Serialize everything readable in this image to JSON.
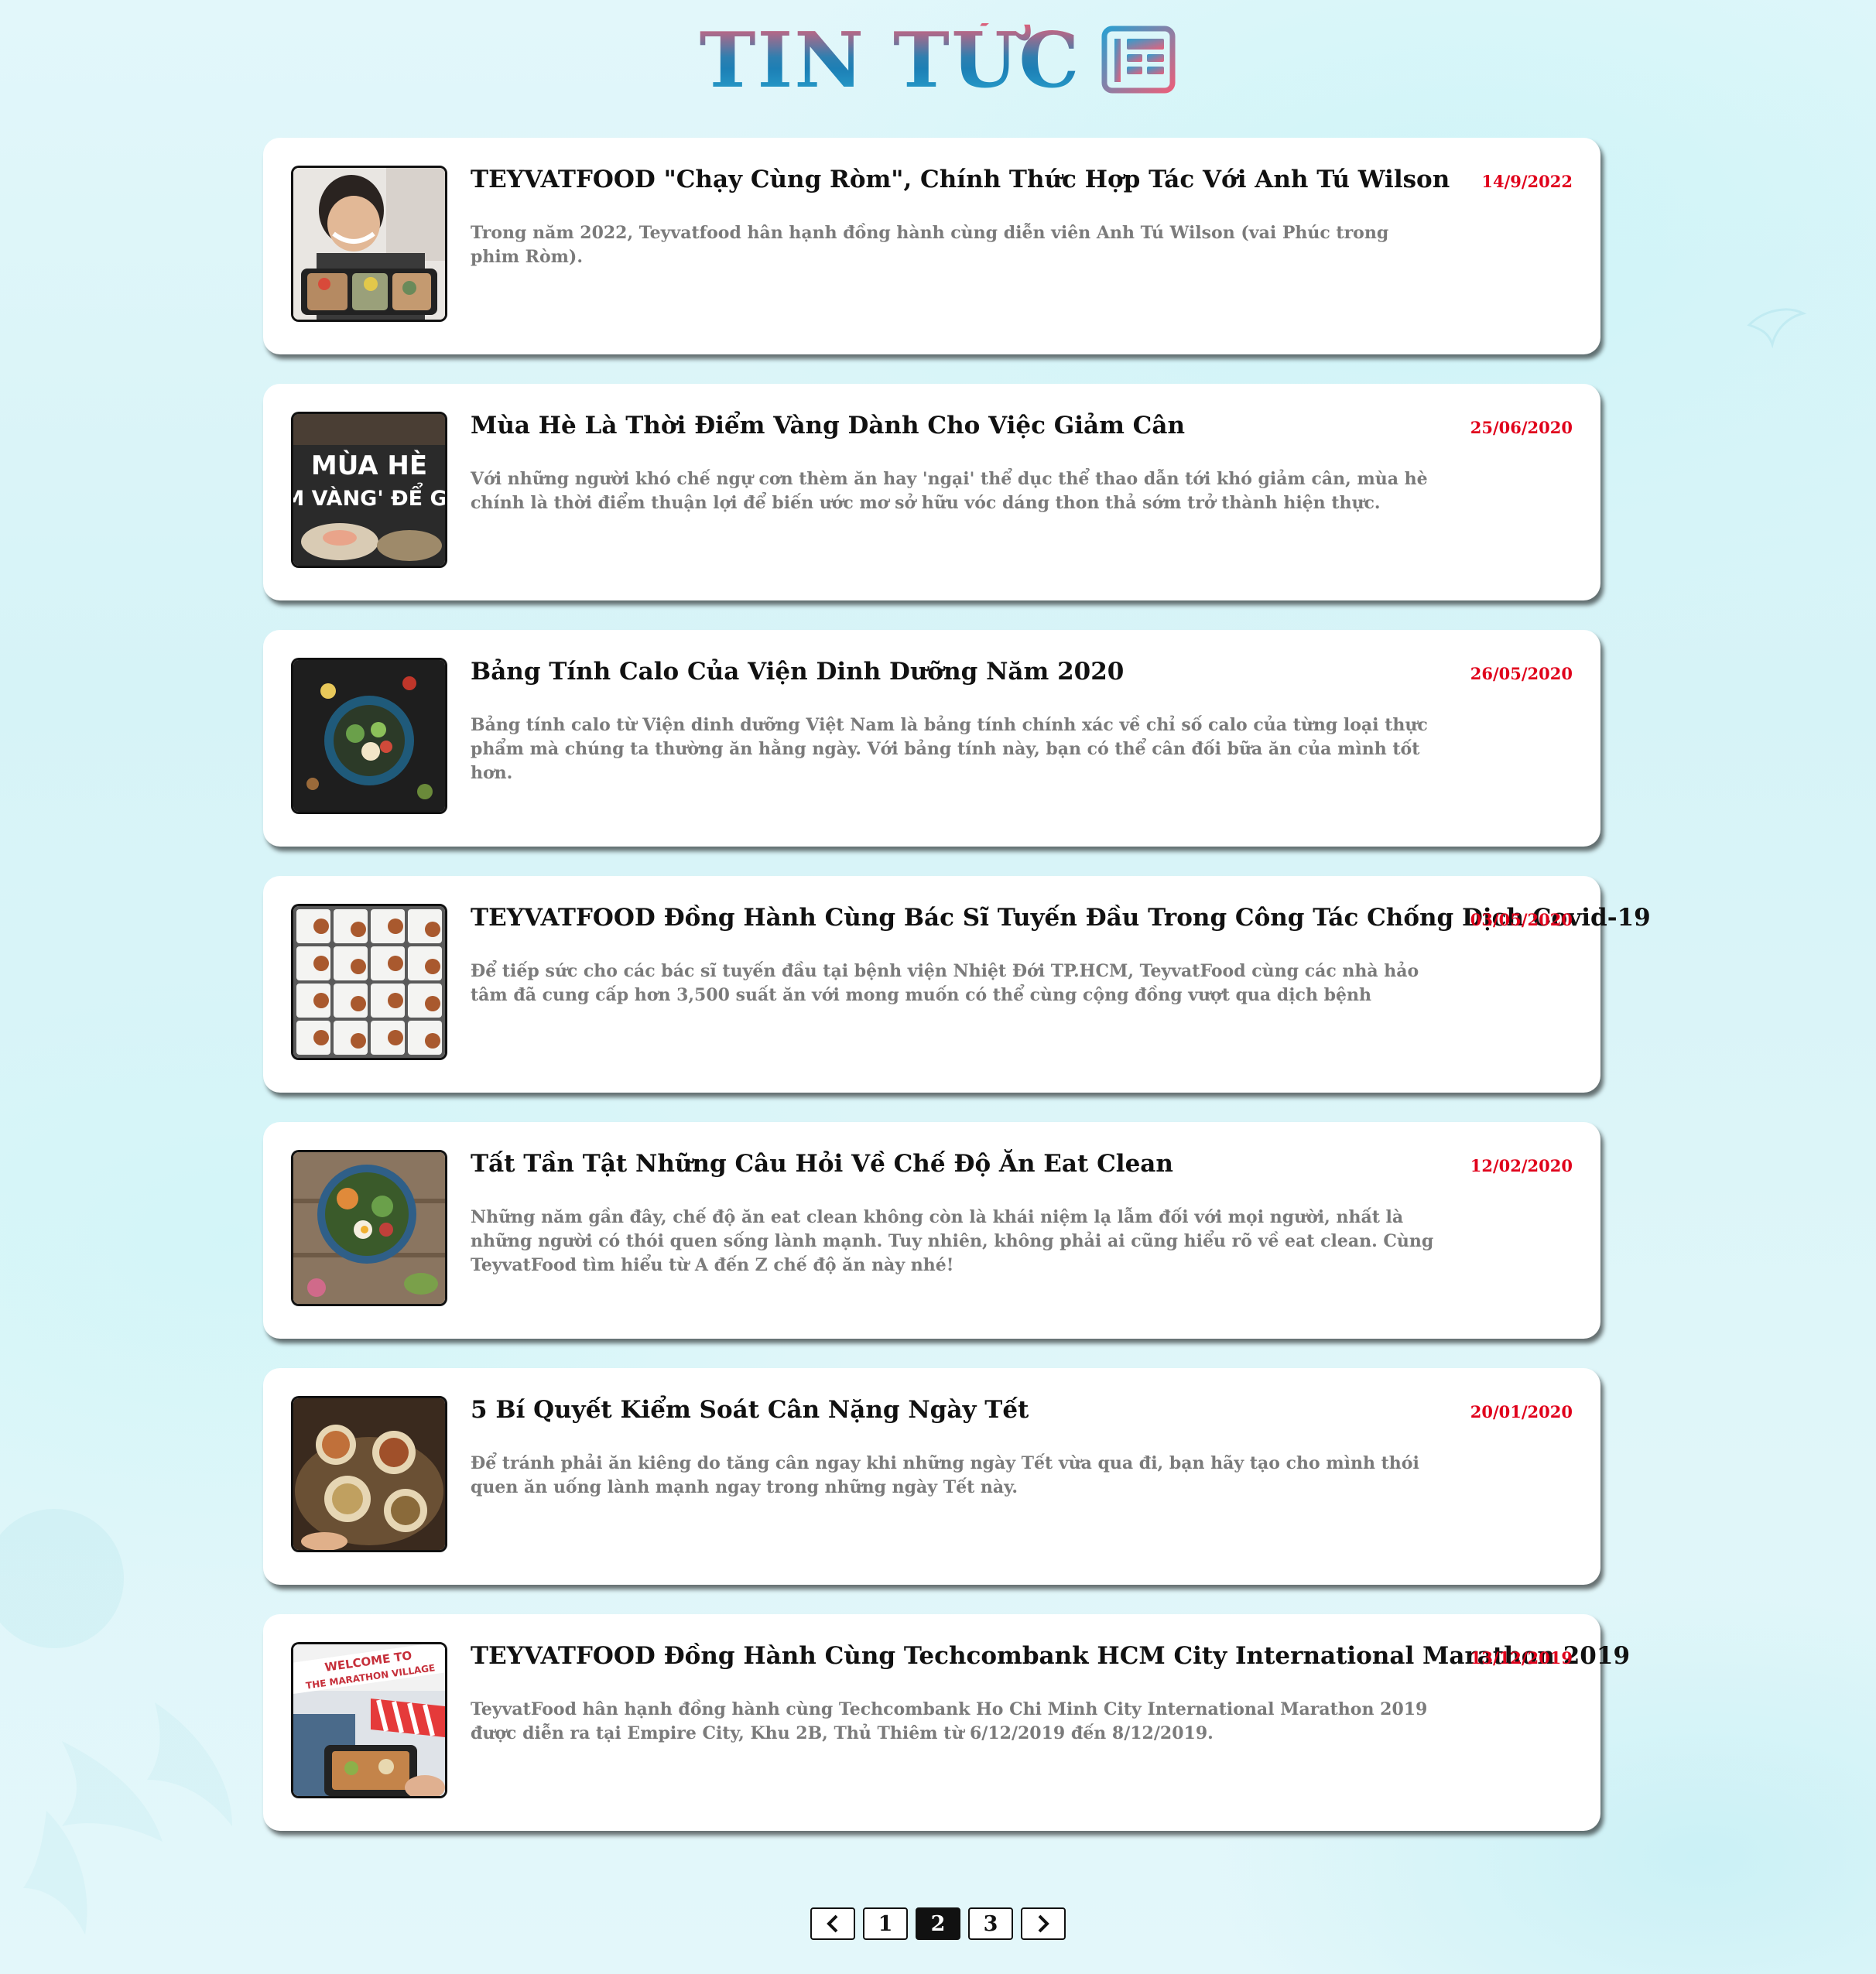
{
  "header": {
    "title": "TIN TỨC",
    "icon": "news-icon"
  },
  "news": [
    {
      "title": "TEYVATFOOD \"Chạy Cùng Ròm\", Chính Thức Hợp Tác Với Anh Tú Wilson",
      "date": "14/9/2022",
      "description": "Trong năm 2022, Teyvatfood hân hạnh đồng hành cùng diễn viên Anh Tú Wilson (vai Phúc trong phim Ròm).",
      "thumbnail": "photo-man-with-meal-boxes"
    },
    {
      "title": "Mùa Hè Là Thời Điểm Vàng Dành Cho Việc Giảm Cân",
      "date": "25/06/2020",
      "description": "Với những người khó chế ngự cơn thèm ăn hay 'ngại' thể dục thể thao dẫn tới khó giảm cân, mùa hè chính là thời điểm thuận lợi để biến ước mơ sở hữu vóc dáng thon thả sớm trở thành hiện thực.",
      "thumbnail": "photo-mua-he-banner",
      "thumbnail_text_1": "MÙA HÈ",
      "thumbnail_text_2": "M VÀNG' ĐỂ GI"
    },
    {
      "title": "Bảng Tính Calo Của Viện Dinh Dưỡng Năm 2020",
      "date": "26/05/2020",
      "description": "Bảng tính calo từ Viện dinh dưỡng Việt Nam là bảng tính chính xác về chỉ số calo của từng loại thực phẩm mà chúng ta thường ăn hằng ngày. Với bảng tính này, bạn có thể cân đối bữa ăn của mình tốt hơn.",
      "thumbnail": "photo-salad-bowl-dark"
    },
    {
      "title": "TEYVATFOOD Đồng Hành Cùng Bác Sĩ Tuyến Đầu Trong Công Tác Chống Dịch Covid-19",
      "date": "03/05/2020",
      "description": "Để tiếp sức cho các bác sĩ tuyến đầu tại bệnh viện Nhiệt Đới TP.HCM, TeyvatFood cùng các nhà hảo tâm đã cung cấp hơn 3,500 suất ăn với mong muốn có thể cùng cộng đồng vượt qua dịch bệnh",
      "thumbnail": "photo-meal-boxes-grid"
    },
    {
      "title": "Tất Tần Tật Những Câu Hỏi Về Chế Độ Ăn Eat Clean",
      "date": "12/02/2020",
      "description": "Những năm gần đây, chế độ ăn eat clean không còn là khái niệm lạ lẫm đối với mọi người, nhất là những người có thói quen sống lành mạnh. Tuy nhiên, không phải ai cũng hiểu rõ về eat clean. Cùng TeyvatFood tìm hiểu từ A đến Z chế độ ăn này nhé!",
      "thumbnail": "photo-eat-clean-bowl"
    },
    {
      "title": "5 Bí Quyết Kiểm Soát Cân Nặng Ngày Tết",
      "date": "20/01/2020",
      "description": "Để tránh phải ăn kiêng do tăng cân ngay khi những ngày Tết vừa qua đi, bạn hãy tạo cho mình thói quen ăn uống lành mạnh ngay trong những ngày Tết này.",
      "thumbnail": "photo-tet-dishes"
    },
    {
      "title": "TEYVATFOOD Đồng Hành Cùng Techcombank HCM City International Marathon 2019",
      "date": "13/12/2019",
      "description": "TeyvatFood hân hạnh đồng hành cùng Techcombank Ho Chi Minh City International Marathon 2019 được diễn ra tại Empire City, Khu 2B, Thủ Thiêm từ 6/12/2019 đến 8/12/2019.",
      "thumbnail": "photo-marathon-village",
      "thumbnail_text_1": "WELCOME TO",
      "thumbnail_text_2": "THE MARATHON VILLAGE"
    }
  ],
  "pagination": {
    "prev_icon": "chevron-left-icon",
    "next_icon": "chevron-right-icon",
    "pages": [
      "1",
      "2",
      "3"
    ],
    "current": "2"
  },
  "colors": {
    "date": "#e0001b",
    "title": "#111111",
    "description": "#7b7b7b",
    "card": "#ffffff"
  }
}
